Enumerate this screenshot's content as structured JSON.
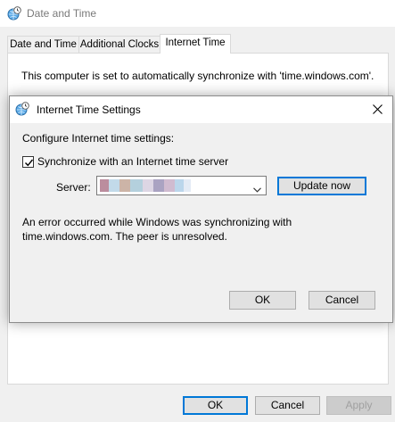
{
  "window": {
    "title": "Date and Time",
    "tabs": [
      {
        "label": "Date and Time"
      },
      {
        "label": "Additional Clocks"
      },
      {
        "label": "Internet Time"
      }
    ],
    "active_tab": "Internet Time",
    "sync_status_text": "This computer is set to automatically synchronize with 'time.windows.com'.",
    "buttons": {
      "ok": "OK",
      "cancel": "Cancel",
      "apply": "Apply"
    }
  },
  "dialog": {
    "title": "Internet Time Settings",
    "config_label": "Configure Internet time settings:",
    "sync_checkbox": {
      "label": "Synchronize with an Internet time server",
      "checked": true
    },
    "server": {
      "label": "Server:",
      "value_obscured": true
    },
    "update_button": "Update now",
    "error_text": "An error occurred while Windows was synchronizing with time.windows.com.  The peer is unresolved.",
    "buttons": {
      "ok": "OK",
      "cancel": "Cancel"
    }
  },
  "colors": {
    "accent": "#0078d7",
    "window_bg": "#f0f0f0",
    "panel_bg": "#ffffff",
    "obscured_swatches": [
      "#b07a8e",
      "#b8d4e6",
      "#c4a898",
      "#a8c8d8",
      "#d8d0e0",
      "#9c94b8",
      "#c8b0c8",
      "#b0d0e8",
      "#e0e8f4"
    ]
  },
  "icons": [
    "clock-globe-icon",
    "close-icon",
    "checkmark-icon",
    "chevron-down-icon"
  ]
}
